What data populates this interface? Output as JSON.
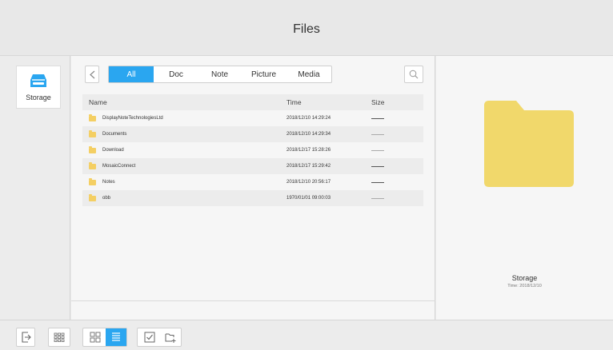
{
  "app": {
    "title": "Files"
  },
  "sidebar": {
    "storage_label": "Storage"
  },
  "filters": {
    "tabs": [
      {
        "label": "All",
        "active": true
      },
      {
        "label": "Doc",
        "active": false
      },
      {
        "label": "Note",
        "active": false
      },
      {
        "label": "Picture",
        "active": false
      },
      {
        "label": "Media",
        "active": false
      }
    ]
  },
  "table": {
    "headers": {
      "name": "Name",
      "time": "Time",
      "size": "Size"
    },
    "rows": [
      {
        "name": "DisplayNoteTechnologiesLtd",
        "time": "2018/12/10 14:29:24"
      },
      {
        "name": "Documents",
        "time": "2018/12/10 14:29:34"
      },
      {
        "name": "Download",
        "time": "2018/12/17 15:28:26"
      },
      {
        "name": "MosaicConnect",
        "time": "2018/12/17 15:29:42"
      },
      {
        "name": "Notes",
        "time": "2018/12/10 20:56:17"
      },
      {
        "name": "obb",
        "time": "1970/01/01 09:00:03"
      }
    ]
  },
  "preview": {
    "name": "Storage",
    "time": "Time: 2018/12/10"
  },
  "colors": {
    "accent": "#2aa6f0",
    "folder": "#f4cf63",
    "background": "#e9e9e9"
  }
}
